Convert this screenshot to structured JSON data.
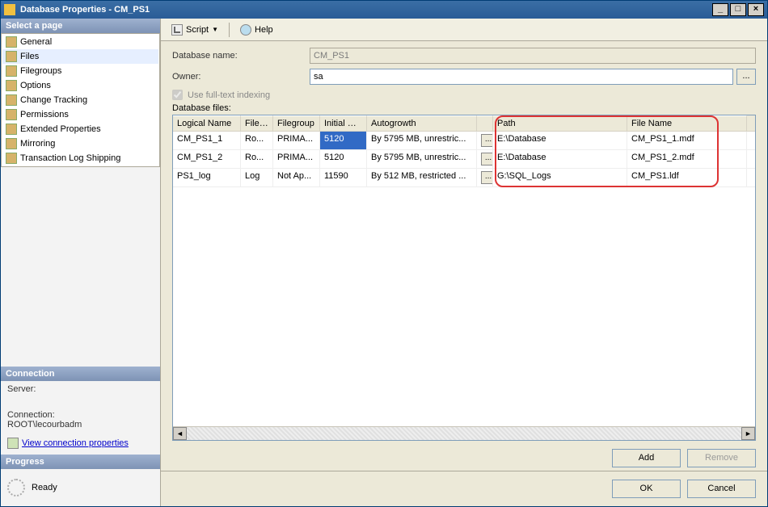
{
  "titlebar": {
    "title": "Database Properties - CM_PS1"
  },
  "sidebar": {
    "header_pages": "Select a page",
    "pages": [
      {
        "label": "General"
      },
      {
        "label": "Files"
      },
      {
        "label": "Filegroups"
      },
      {
        "label": "Options"
      },
      {
        "label": "Change Tracking"
      },
      {
        "label": "Permissions"
      },
      {
        "label": "Extended Properties"
      },
      {
        "label": "Mirroring"
      },
      {
        "label": "Transaction Log Shipping"
      }
    ],
    "header_connection": "Connection",
    "server_label": "Server:",
    "server_value": "",
    "connection_label": "Connection:",
    "connection_value": "ROOT\\lecourbadm",
    "view_conn_props": "View connection properties",
    "header_progress": "Progress",
    "progress_status": "Ready"
  },
  "toolbar": {
    "script": "Script",
    "help": "Help"
  },
  "form": {
    "dbname_label": "Database name:",
    "dbname_value": "CM_PS1",
    "owner_label": "Owner:",
    "owner_value": "sa",
    "fulltext_label": "Use full-text indexing"
  },
  "grid": {
    "label": "Database files:",
    "headers": {
      "logical": "Logical Name",
      "filetype": "File ...",
      "filegroup": "Filegroup",
      "initsize": "Initial Siz...",
      "autogrowth": "Autogrowth",
      "path": "Path",
      "filename": "File Name"
    },
    "rows": [
      {
        "logical": "CM_PS1_1",
        "filetype": "Ro...",
        "filegroup": "PRIMA...",
        "initsize": "5120",
        "autogrowth": "By 5795 MB, unrestric...",
        "path": "E:\\Database",
        "filename": "CM_PS1_1.mdf",
        "selected": true
      },
      {
        "logical": "CM_PS1_2",
        "filetype": "Ro...",
        "filegroup": "PRIMA...",
        "initsize": "5120",
        "autogrowth": "By 5795 MB, unrestric...",
        "path": "E:\\Database",
        "filename": "CM_PS1_2.mdf",
        "selected": false
      },
      {
        "logical": "PS1_log",
        "filetype": "Log",
        "filegroup": "Not Ap...",
        "initsize": "11590",
        "autogrowth": "By 512 MB, restricted ...",
        "path": "G:\\SQL_Logs",
        "filename": "CM_PS1.ldf",
        "selected": false
      }
    ]
  },
  "buttons": {
    "add": "Add",
    "remove": "Remove",
    "ok": "OK",
    "cancel": "Cancel"
  }
}
